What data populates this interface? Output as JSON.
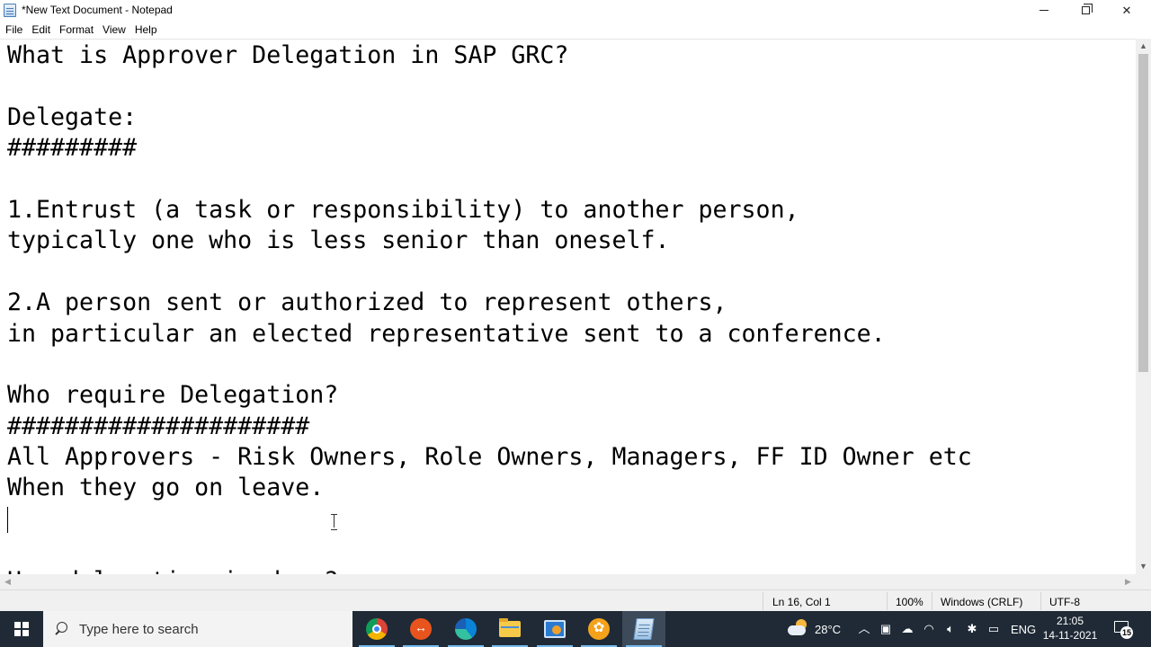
{
  "window": {
    "title": "*New Text Document - Notepad",
    "icon": "notepad-icon"
  },
  "menu": [
    "File",
    "Edit",
    "Format",
    "View",
    "Help"
  ],
  "editor": {
    "lines": [
      "What is Approver Delegation in SAP GRC?",
      "",
      "Delegate:",
      "#########",
      "",
      "1.Entrust (a task or responsibility) to another person,",
      "typically one who is less senior than oneself.",
      "",
      "2.A person sent or authorized to represent others,",
      "in particular an elected representative sent to a conference.",
      "",
      "Who require Delegation?",
      "#####################",
      "All Approvers - Risk Owners, Role Owners, Managers, FF ID Owner etc",
      "When they go on leave.",
      "",
      "",
      "How delegation is done?"
    ]
  },
  "status": {
    "position": "Ln 16, Col 1",
    "zoom": "100%",
    "line_ending": "Windows (CRLF)",
    "encoding": "UTF-8"
  },
  "taskbar": {
    "search_placeholder": "Type here to search",
    "apps": [
      "chrome-icon",
      "remote-desktop-manager-icon",
      "edge-icon",
      "file-explorer-icon",
      "remote-desktop-icon",
      "app-flower-icon",
      "notepad-icon"
    ],
    "weather": "28°C",
    "language": "ENG",
    "time": "21:05",
    "date": "14-11-2021",
    "notification_count": "15"
  }
}
